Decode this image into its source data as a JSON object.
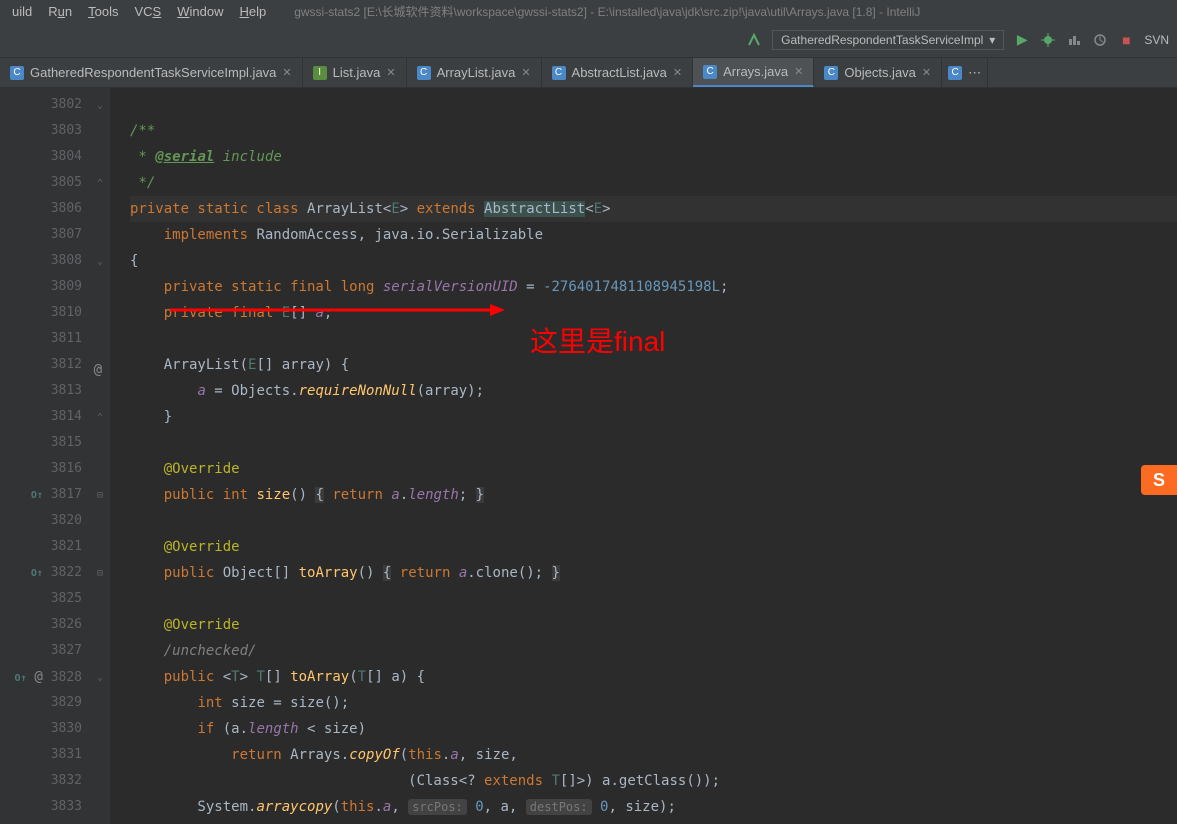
{
  "menubar": {
    "items": [
      "uild",
      "Run",
      "Tools",
      "VCS",
      "Window",
      "Help"
    ],
    "title": "gwssi-stats2 [E:\\长城软件资料\\workspace\\gwssi-stats2] - E:\\installed\\java\\jdk\\src.zip!\\java\\util\\Arrays.java [1.8] - IntelliJ"
  },
  "toolbar": {
    "dropdown": "GatheredRespondentTaskServiceImpl",
    "svn": "SVN"
  },
  "tabs": [
    {
      "label": "GatheredRespondentTaskServiceImpl.java",
      "type": "class",
      "active": false
    },
    {
      "label": "List.java",
      "type": "interface",
      "active": false
    },
    {
      "label": "ArrayList.java",
      "type": "class",
      "active": false
    },
    {
      "label": "AbstractList.java",
      "type": "class",
      "active": false
    },
    {
      "label": "Arrays.java",
      "type": "class",
      "active": true
    },
    {
      "label": "Objects.java",
      "type": "class",
      "active": false
    }
  ],
  "annotation": "这里是final",
  "gutter": {
    "lines": [
      "3802",
      "3803",
      "3804",
      "3805",
      "3806",
      "3807",
      "3808",
      "3809",
      "3810",
      "3811",
      "3812",
      "3813",
      "3814",
      "3815",
      "3816",
      "3817",
      "3820",
      "3821",
      "3822",
      "3825",
      "3826",
      "3827",
      "3828",
      "3829",
      "3830",
      "3831",
      "3832",
      "3833"
    ]
  },
  "code": {
    "serialVersionUID": "-2764017481108945198L",
    "hint_src": "srcPos:",
    "hint_dest": "destPos:",
    "val_zero": "0",
    "suppressed": "/unchecked/"
  }
}
